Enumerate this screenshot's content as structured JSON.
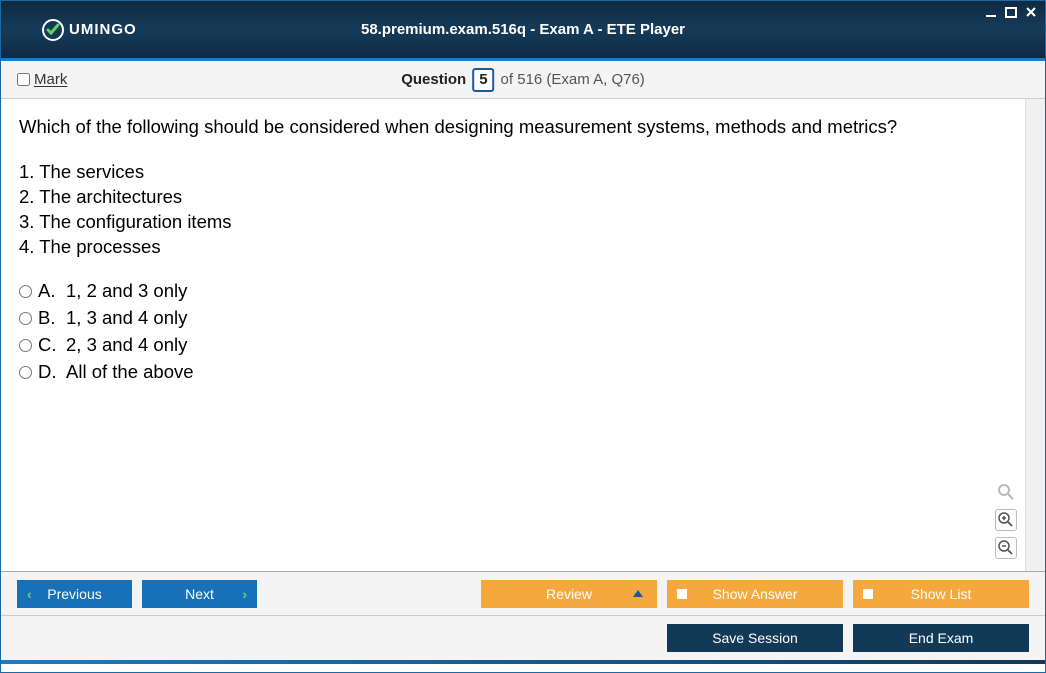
{
  "window": {
    "title": "58.premium.exam.516q - Exam A - ETE Player",
    "logo_text": "UMINGO"
  },
  "question_bar": {
    "mark_label": "Mark",
    "question_label": "Question",
    "current_number": "5",
    "of_text": "of 516 (Exam A, Q76)"
  },
  "content": {
    "question": "Which of the following should be considered when designing measurement systems, methods and metrics?",
    "items": [
      "1. The services",
      "2. The architectures",
      "3. The configuration items",
      "4. The processes"
    ],
    "answers": [
      {
        "letter": "A.",
        "text": "1, 2 and 3 only"
      },
      {
        "letter": "B.",
        "text": "1, 3 and 4 only"
      },
      {
        "letter": "C.",
        "text": "2, 3 and 4 only"
      },
      {
        "letter": "D.",
        "text": "All of the above"
      }
    ]
  },
  "buttons": {
    "previous": "Previous",
    "next": "Next",
    "review": "Review",
    "show_answer": "Show Answer",
    "show_list": "Show List",
    "save_session": "Save Session",
    "end_exam": "End Exam"
  }
}
